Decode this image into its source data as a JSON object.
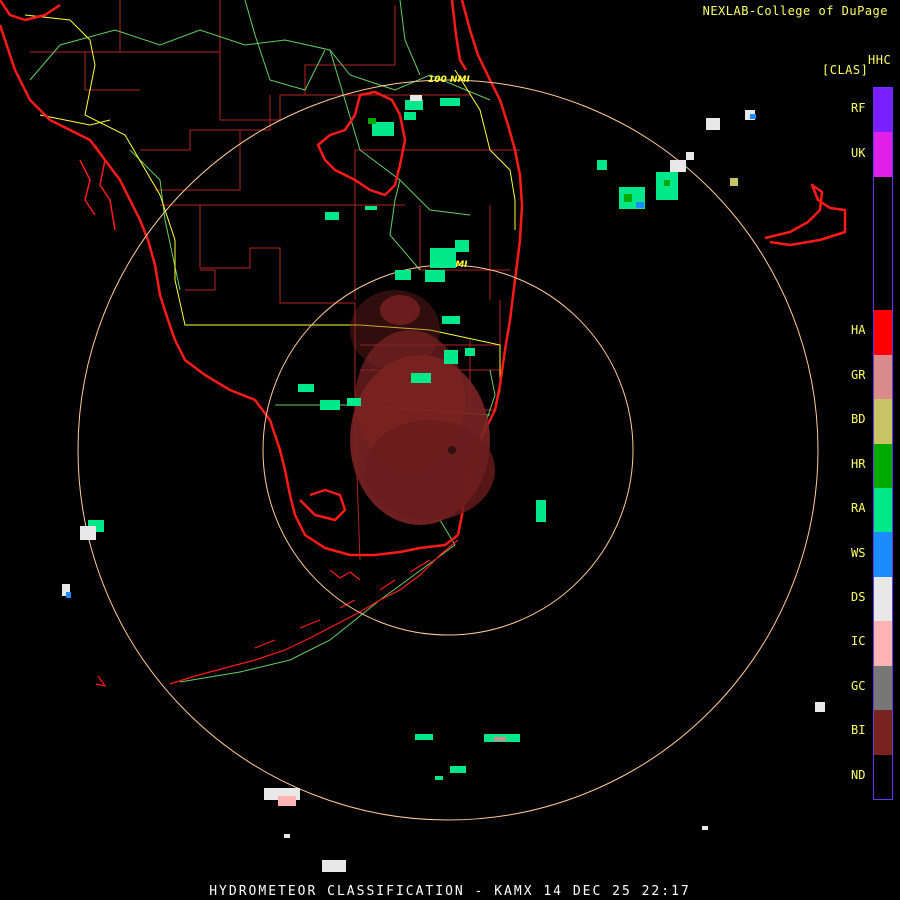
{
  "header": {
    "credit": "NEXLAB-College of DuPage",
    "product_code": "HHC",
    "product_class": "[CLAS]"
  },
  "footer": {
    "title": "HYDROMETEOR CLASSIFICATION - KAMX 14 DEC 25 22:17"
  },
  "range_rings": [
    "50 NMI",
    "100 NMI"
  ],
  "colors": {
    "coastline": "#ff1a1a",
    "county_lines": "#b22222",
    "state_roads": "#ffff33",
    "highways": "#66cc66",
    "range_rings": "#ffcc99",
    "biological_echo": "#7a2222"
  },
  "legend": [
    {
      "code": "RF",
      "color": "#7a1fff"
    },
    {
      "code": "UK",
      "color": "#e01fe8"
    },
    {
      "code": "",
      "color": "#000000"
    },
    {
      "code": "",
      "color": "#000000"
    },
    {
      "code": "",
      "color": "#000000"
    },
    {
      "code": "HA",
      "color": "#ff0000"
    },
    {
      "code": "GR",
      "color": "#d98a8a"
    },
    {
      "code": "BD",
      "color": "#c8c466"
    },
    {
      "code": "HR",
      "color": "#00aa00"
    },
    {
      "code": "RA",
      "color": "#00e88a"
    },
    {
      "code": "WS",
      "color": "#1a8cff"
    },
    {
      "code": "DS",
      "color": "#e8e8e8"
    },
    {
      "code": "IC",
      "color": "#ffb3b3"
    },
    {
      "code": "GC",
      "color": "#777777"
    },
    {
      "code": "BI",
      "color": "#7a2222"
    },
    {
      "code": "ND",
      "color": "#000000"
    }
  ]
}
